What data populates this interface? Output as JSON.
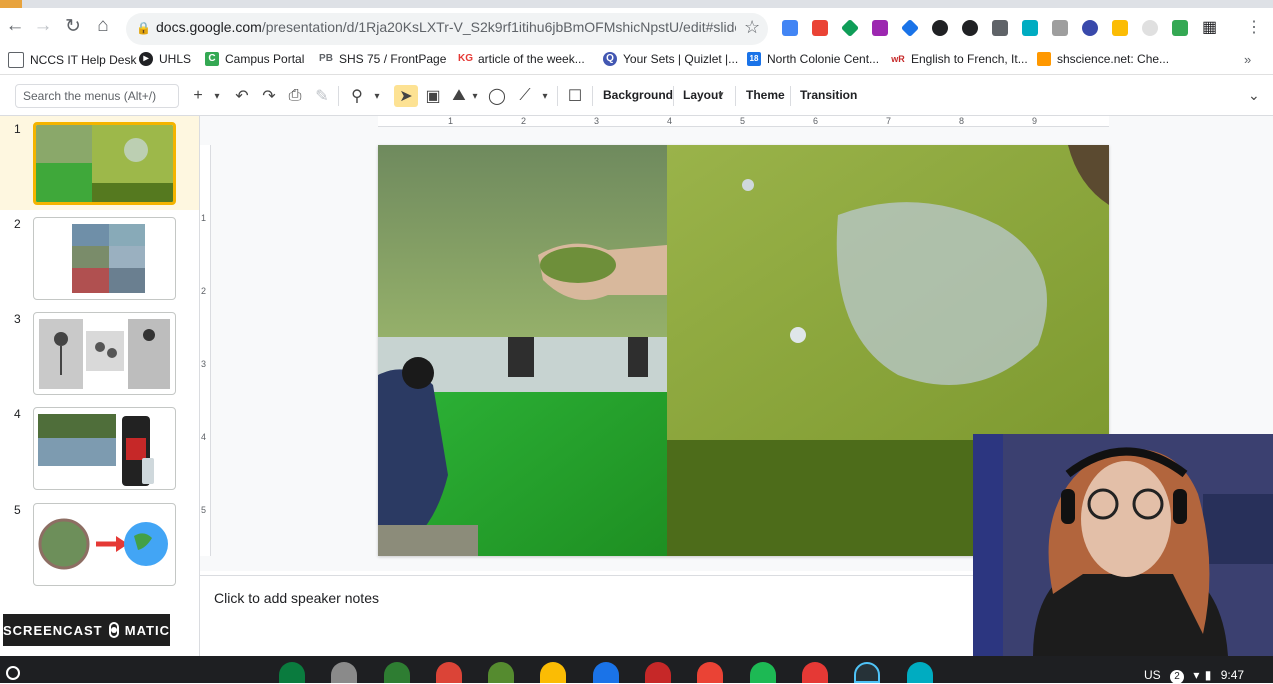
{
  "browser": {
    "url_host": "docs.google.com",
    "url_path": "/presentation/d/1Rja20KsLXTr-V_S2k9rf1itihu6jbBmOFMshicNpstU/edit#slide=..."
  },
  "bookmarks": [
    {
      "label": "NCCS IT Help Desk",
      "icon": "page-icon"
    },
    {
      "label": "UHLS",
      "icon": "play-icon"
    },
    {
      "label": "Campus Portal",
      "icon": "c-logo-icon"
    },
    {
      "label": "SHS 75 / FrontPage",
      "icon": "pb-logo-icon"
    },
    {
      "label": "article of the week...",
      "icon": "kg-logo-icon"
    },
    {
      "label": "Your Sets | Quizlet |...",
      "icon": "quizlet-icon"
    },
    {
      "label": "North Colonie Cent...",
      "icon": "calendar-icon"
    },
    {
      "label": "English to French, It...",
      "icon": "wr-logo-icon"
    },
    {
      "label": "shscience.net: Che...",
      "icon": "shscience-icon"
    }
  ],
  "toolbar": {
    "search_placeholder": "Search the menus (Alt+/)",
    "background": "Background",
    "layout": "Layout",
    "theme": "Theme",
    "transition": "Transition"
  },
  "slides": [
    {
      "num": "1"
    },
    {
      "num": "2"
    },
    {
      "num": "3"
    },
    {
      "num": "4"
    },
    {
      "num": "5"
    }
  ],
  "ruler": {
    "h": [
      "1",
      "2",
      "3",
      "4",
      "5",
      "6",
      "7",
      "8",
      "9"
    ],
    "v": [
      "1",
      "2",
      "3",
      "4",
      "5"
    ]
  },
  "notes": {
    "placeholder": "Click to add speaker notes"
  },
  "watermark": {
    "left": "SCREENCAST",
    "right": "MATIC"
  },
  "status": {
    "locale": "US",
    "notifications": "2",
    "time": "9:47"
  },
  "colors": {
    "accent": "#f4b400",
    "selected_bg": "#fef7e0"
  }
}
